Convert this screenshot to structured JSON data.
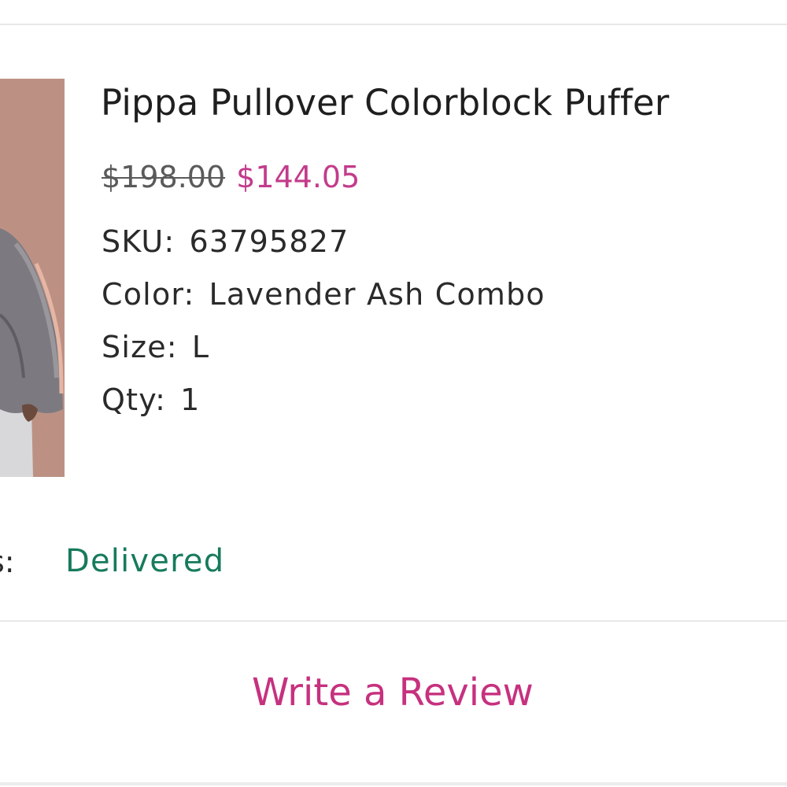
{
  "product": {
    "title": "Pippa Pullover Colorblock Puffer",
    "price_original": "$198.00",
    "price_sale": "$144.05",
    "sku_label": "SKU:",
    "sku_value": "63795827",
    "color_label": "Color:",
    "color_value": "Lavender Ash Combo",
    "size_label": "Size:",
    "size_value": "L",
    "qty_label": "Qty:",
    "qty_value": "1"
  },
  "status": {
    "label": "s:",
    "value": "Delivered"
  },
  "actions": {
    "review_label": "Write a Review"
  },
  "colors": {
    "sale_price": "#c33b8b",
    "status_delivered": "#177a5c",
    "review_link": "#c6317f"
  }
}
